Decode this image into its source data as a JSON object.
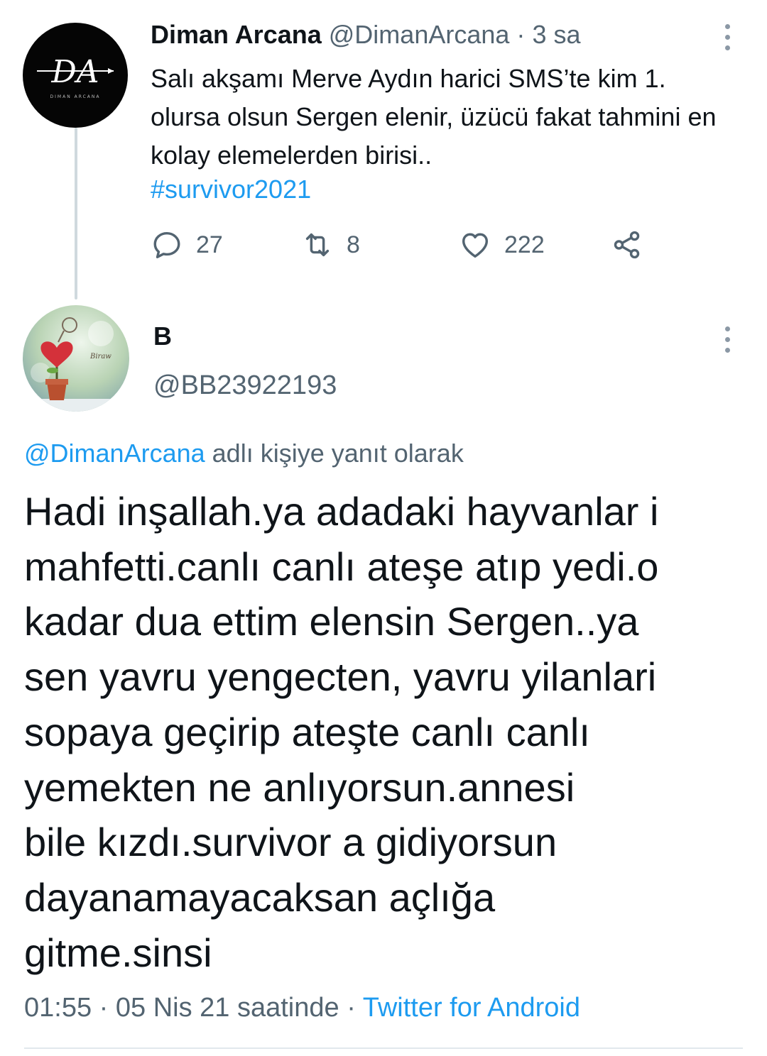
{
  "parent_tweet": {
    "display_name": "Diman Arcana",
    "handle": "@DimanArcana",
    "separator": "·",
    "time": "3 sa",
    "text": "Salı akşamı Merve Aydın harici SMS’te kim 1. olursa olsun Sergen elenir, üzücü fakat tahmini en kolay elemelerden birisi..",
    "hashtag": "#survivor2021",
    "avatar": {
      "logo_text": "DA",
      "logo_subtext": "DIMAN ARCANA",
      "background": "#050505"
    },
    "actions": {
      "replies": "27",
      "retweets": "8",
      "likes": "222"
    },
    "icons": [
      "reply-icon",
      "retweet-icon",
      "like-icon",
      "share-icon",
      "more-options-icon"
    ]
  },
  "reply_tweet": {
    "display_name": "B",
    "handle": "@BB23922193",
    "avatar": {
      "signature": "Biraw"
    },
    "reply_to": {
      "handle": "@DimanArcana",
      "suffix": "adlı kişiye yanıt olarak"
    },
    "text": "Hadi inşallah.ya adadaki hayvanlar i\nmahfetti.canlı canlı ateşe atıp yedi.o\nkadar dua ettim elensin Sergen..ya\nsen yavru yengecten, yavru yilanlari\nsopaya geçirip ateşte canlı canlı\nyemekten ne anlıyorsun.annesi\nbile kızdı.survivor a gidiyorsun\ndayanamayacaksan açlığa\ngitme.sinsi",
    "timestamp": "01:55 · 05 Nis 21 saatinde",
    "separator": "·",
    "source": "Twitter for Android"
  },
  "colors": {
    "link": "#1d9bf0",
    "muted": "#536471",
    "text": "#0f1419",
    "thread_line": "#cfd9de"
  }
}
